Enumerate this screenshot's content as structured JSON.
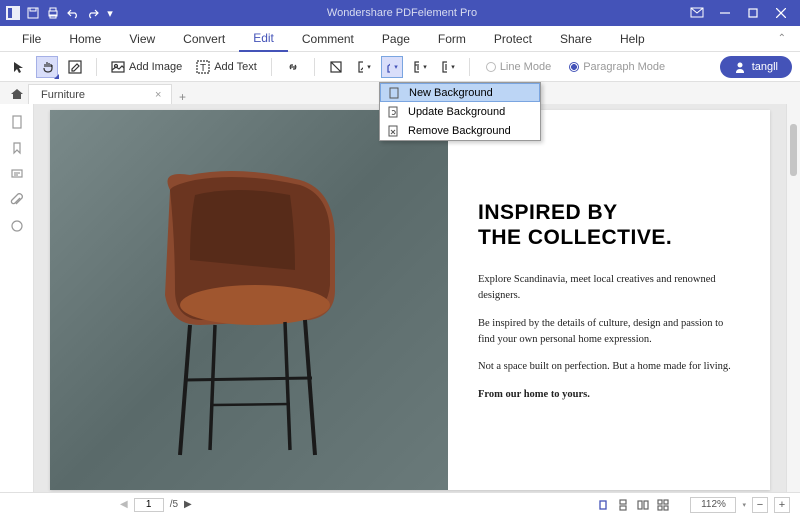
{
  "titlebar": {
    "app_title": "Wondershare PDFelement Pro"
  },
  "menu": {
    "items": [
      "File",
      "Home",
      "View",
      "Convert",
      "Edit",
      "Comment",
      "Page",
      "Form",
      "Protect",
      "Share",
      "Help"
    ],
    "active": "Edit"
  },
  "toolbar": {
    "add_image": "Add Image",
    "add_text": "Add Text",
    "line_mode": "Line Mode",
    "paragraph_mode": "Paragraph Mode"
  },
  "user": {
    "name": "tangll"
  },
  "tab": {
    "name": "Furniture"
  },
  "dropdown": {
    "new_bg": "New Background",
    "update_bg": "Update Background",
    "remove_bg": "Remove Background"
  },
  "doc": {
    "h1a": "INSPIRED BY",
    "h1b": "THE COLLECTIVE.",
    "p1": "Explore Scandinavia, meet local creatives and renowned designers.",
    "p2": "Be inspired by the details of culture, design and passion to find your own personal home expression.",
    "p3": "Not a space built on perfection. But a home made for living.",
    "p4": "From our home to yours."
  },
  "status": {
    "page_cur": "1",
    "page_total": "/5",
    "zoom": "112%"
  }
}
